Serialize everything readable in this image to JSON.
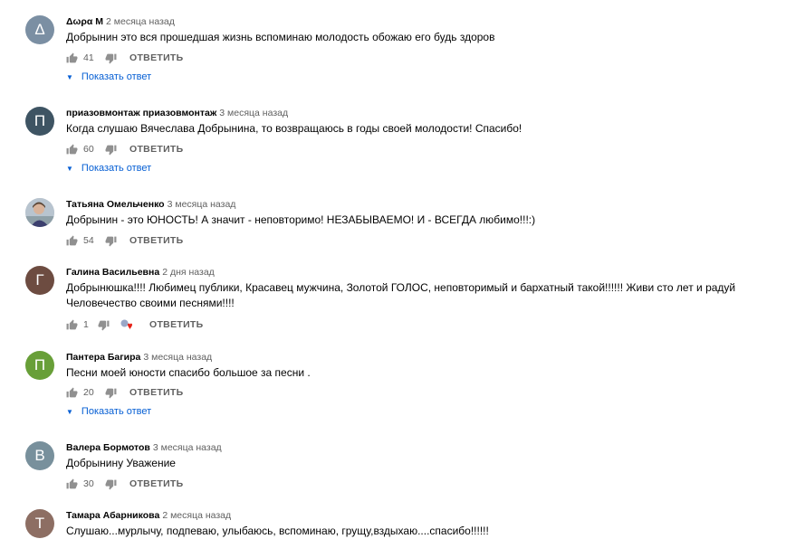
{
  "reply_label": "ОТВЕТИТЬ",
  "show_replies_label": "Показать ответ",
  "colors": {
    "link": "#065fd4",
    "meta": "#606060",
    "text": "#030303"
  },
  "comments": [
    {
      "avatar_letter": "Δ",
      "avatar_color": "#7b8fa3",
      "author": "Δωρα Μ",
      "time": "2 месяца назад",
      "text": "Добрынин это вся  прошедшая жизнь  вспоминаю молодость  обожаю его будь здоров",
      "likes": "41"
    },
    {
      "avatar_letter": "П",
      "avatar_color": "#3e5463",
      "author": "приазовмонтаж приазовмонтаж",
      "time": "3 месяца назад",
      "text": "Когда слушаю Вячеслава Добрынина, то возвращаюсь в годы своей молодости! Спасибо!",
      "likes": "60"
    },
    {
      "avatar_letter": "",
      "avatar_color": "#c9cdd3",
      "author": "Татьяна Омельченко",
      "time": "3 месяца назад",
      "text": "Добрынин - это ЮНОСТЬ! А значит - неповторимо! НЕЗАБЫВАЕМО! И - ВСЕГДА любимо!!!:)",
      "likes": "54"
    },
    {
      "avatar_letter": "Г",
      "avatar_color": "#6d4c41",
      "author": "Галина Васильевна",
      "time": "2 дня назад",
      "text": "Добрынюшка!!!! Любимец публики, Красавец мужчина, Золотой ГОЛОС, неповторимый и бархатный такой!!!!!! Живи сто лет и радуй Человечество своими песнями!!!!",
      "likes": "1"
    },
    {
      "avatar_letter": "П",
      "avatar_color": "#689f38",
      "author": "Пантера Багира",
      "time": "3 месяца назад",
      "text": "Песни моей  юности спасибо большое за песни .",
      "likes": "20"
    },
    {
      "avatar_letter": "В",
      "avatar_color": "#78909c",
      "author": "Валера Бормотов",
      "time": "3 месяца назад",
      "text": "Добрынину Уважение",
      "likes": "30"
    },
    {
      "avatar_letter": "Т",
      "avatar_color": "#8d6e63",
      "author": "Тамара Абарникова",
      "time": "2 месяца назад",
      "text": "Слушаю...мурлычу, подпеваю, улыбаюсь, вспоминаю, грущу,вздыхаю....спасибо!!!!!!",
      "likes": ""
    }
  ]
}
